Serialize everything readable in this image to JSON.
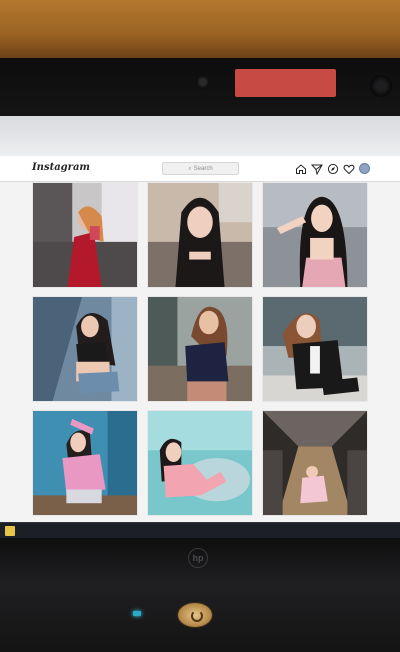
{
  "header": {
    "logo_text": "Instagram",
    "search_placeholder": "Search"
  },
  "nav_icons": [
    "home-icon",
    "direct-message-icon",
    "explore-icon",
    "activity-heart-icon",
    "profile-avatar"
  ],
  "posts": [
    {
      "row": 1,
      "col": 1,
      "subject": "woman in red dress taking mirror selfie"
    },
    {
      "row": 1,
      "col": 2,
      "subject": "woman with long dark hair"
    },
    {
      "row": 1,
      "col": 3,
      "subject": "woman in pink top"
    },
    {
      "row": 2,
      "col": 1,
      "subject": "woman in black top and denim shorts"
    },
    {
      "row": 2,
      "col": 2,
      "subject": "woman in navy top"
    },
    {
      "row": 2,
      "col": 3,
      "subject": "woman in black suit"
    },
    {
      "row": 3,
      "col": 1,
      "subject": "woman in pink outfit on blue background"
    },
    {
      "row": 3,
      "col": 2,
      "subject": "woman in pink on teal bed"
    },
    {
      "row": 3,
      "col": 3,
      "subject": "woman crouching on bridge walkway"
    }
  ],
  "colors": {
    "desk": "#a26a28",
    "bezel": "#111112",
    "privacy_shutter": "#c74a45",
    "screen_bg": "#f3f3f4",
    "ig_text": "#262626",
    "power_button": "#d1a96a",
    "status_led": "#2aa9c9"
  }
}
